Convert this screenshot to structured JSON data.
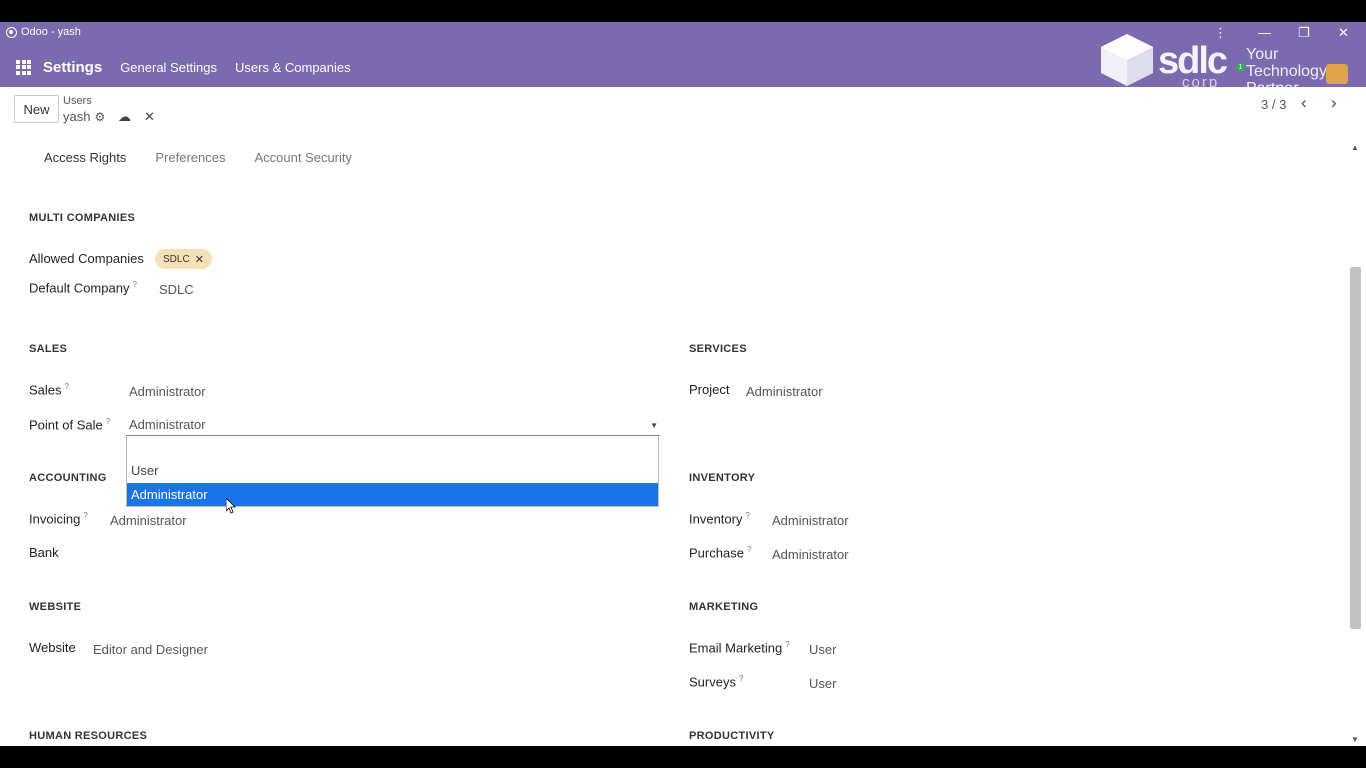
{
  "window": {
    "title": "Odoo - yash"
  },
  "nav": {
    "brand": "Settings",
    "menu": [
      "General Settings",
      "Users & Companies"
    ]
  },
  "logo": {
    "word": "sdlc",
    "corp": "corp",
    "tagline_1": "Your",
    "tagline_2": "Technology",
    "tagline_3": "Partner",
    "badge": "1"
  },
  "control": {
    "new_label": "New",
    "breadcrumb_parent": "Users",
    "breadcrumb_current": "yash",
    "pager": "3 / 3"
  },
  "tabs": [
    "Access Rights",
    "Preferences",
    "Account Security"
  ],
  "multi_companies": {
    "title": "MULTI COMPANIES",
    "allowed_label": "Allowed Companies",
    "allowed_tag": "SDLC",
    "default_label": "Default Company",
    "default_value": "SDLC"
  },
  "sales": {
    "title": "SALES",
    "sales_label": "Sales",
    "sales_value": "Administrator",
    "pos_label": "Point of Sale",
    "pos_value": "Administrator"
  },
  "dropdown": {
    "options": [
      "User",
      "Administrator"
    ],
    "selected": "Administrator"
  },
  "services": {
    "title": "SERVICES",
    "project_label": "Project",
    "project_value": "Administrator"
  },
  "accounting": {
    "title": "ACCOUNTING",
    "invoicing_label": "Invoicing",
    "invoicing_value": "Administrator",
    "bank_label": "Bank"
  },
  "inventory": {
    "title": "INVENTORY",
    "inventory_label": "Inventory",
    "inventory_value": "Administrator",
    "purchase_label": "Purchase",
    "purchase_value": "Administrator"
  },
  "website": {
    "title": "WEBSITE",
    "website_label": "Website",
    "website_value": "Editor and Designer"
  },
  "marketing": {
    "title": "MARKETING",
    "email_label": "Email Marketing",
    "email_value": "User",
    "surveys_label": "Surveys",
    "surveys_value": "User"
  },
  "human_resources": {
    "title": "HUMAN RESOURCES"
  },
  "productivity": {
    "title": "PRODUCTIVITY"
  },
  "help_mark": "?",
  "colors": {
    "topbar": "#7b6aae",
    "tag": "#f4e1b8",
    "selected": "#1a73e8"
  }
}
